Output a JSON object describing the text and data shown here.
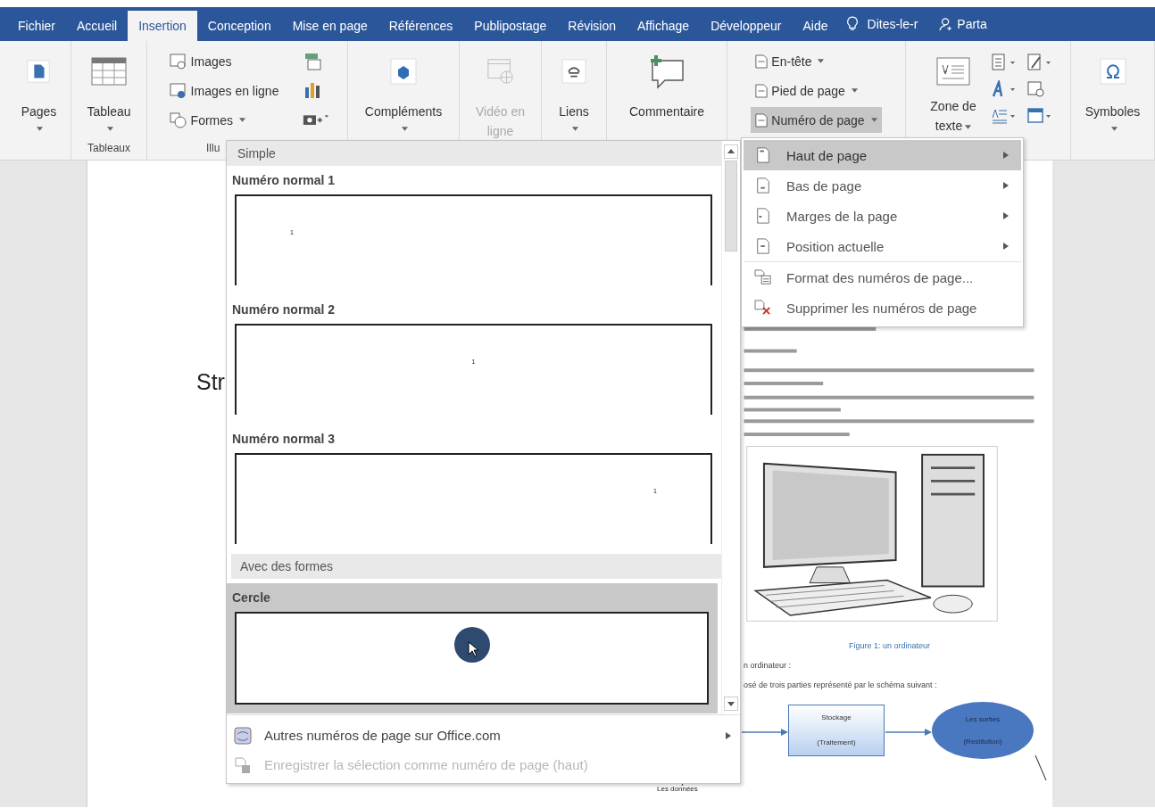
{
  "tabs": [
    {
      "label": "Fichier",
      "selected": false
    },
    {
      "label": "Accueil",
      "selected": false
    },
    {
      "label": "Insertion",
      "selected": true
    },
    {
      "label": "Conception",
      "selected": false
    },
    {
      "label": "Mise en page",
      "selected": false
    },
    {
      "label": "Références",
      "selected": false
    },
    {
      "label": "Publipostage",
      "selected": false
    },
    {
      "label": "Révision",
      "selected": false
    },
    {
      "label": "Affichage",
      "selected": false
    },
    {
      "label": "Développeur",
      "selected": false
    },
    {
      "label": "Aide",
      "selected": false
    }
  ],
  "tell_me": "Dites-le-r",
  "share": "Parta",
  "ribbon": {
    "groups": [
      {
        "kind": "large",
        "buttons": [
          {
            "label": "Pages",
            "dropdown": true,
            "disabled": false
          }
        ]
      },
      {
        "kind": "large",
        "label": "Tableaux",
        "buttons": [
          {
            "label": "Tableau",
            "dropdown": true,
            "disabled": false
          }
        ]
      },
      {
        "kind": "stack",
        "label": "Illu",
        "items": [
          {
            "label": "Images",
            "dropdown": false,
            "selected": false
          },
          {
            "label": "Images en ligne",
            "dropdown": false,
            "selected": false
          },
          {
            "label": "Formes",
            "dropdown": true,
            "selected": false
          }
        ]
      },
      {
        "kind": "large",
        "buttons": [
          {
            "label": "Compléments",
            "dropdown": true,
            "disabled": false
          }
        ]
      },
      {
        "kind": "large",
        "buttons": [
          {
            "label": "Vidéo en ligne",
            "dropdown": false,
            "disabled": true
          }
        ]
      },
      {
        "kind": "large",
        "buttons": [
          {
            "label": "Liens",
            "dropdown": true,
            "disabled": false
          }
        ]
      },
      {
        "kind": "large",
        "buttons": [
          {
            "label": "Commentaire",
            "dropdown": false,
            "disabled": false
          }
        ]
      },
      {
        "kind": "stack",
        "items": [
          {
            "label": "En-tête",
            "dropdown": true,
            "selected": false
          },
          {
            "label": "Pied de page",
            "dropdown": true,
            "selected": false
          },
          {
            "label": "Numéro de page",
            "dropdown": true,
            "selected": true
          }
        ]
      },
      {
        "kind": "large",
        "buttons": [
          {
            "label": "Zone de texte",
            "dropdown": true,
            "disabled": false
          }
        ]
      },
      {
        "kind": "large",
        "buttons": [
          {
            "label": "Symboles",
            "dropdown": true,
            "disabled": false
          }
        ]
      }
    ]
  },
  "gallery": {
    "sections": [
      {
        "heading": "Simple",
        "items": [
          {
            "kind": "left",
            "label": "Numéro normal 1",
            "number": "1",
            "selected": false
          },
          {
            "kind": "center",
            "label": "Numéro normal 2",
            "number": "1",
            "selected": false
          },
          {
            "kind": "right",
            "label": "Numéro normal 3",
            "number": "1",
            "selected": false
          }
        ]
      },
      {
        "heading": "Avec des formes",
        "items": [
          {
            "kind": "circle",
            "label": "Cercle",
            "selected": true
          }
        ]
      }
    ],
    "footer": [
      {
        "label": "Autres numéros de page sur Office.com",
        "submenu": true,
        "disabled": false
      },
      {
        "label": "Enregistrer la sélection comme numéro de page (haut)",
        "submenu": false,
        "disabled": true
      }
    ]
  },
  "submenu": [
    {
      "label": "Haut de page",
      "selected": true,
      "submenu": true,
      "separator_before": false
    },
    {
      "label": "Bas de page",
      "selected": false,
      "submenu": true,
      "separator_before": false
    },
    {
      "label": "Marges de la page",
      "selected": false,
      "submenu": true,
      "separator_before": false
    },
    {
      "label": "Position actuelle",
      "selected": false,
      "submenu": true,
      "separator_before": false
    },
    {
      "label": "Format des numéros de page...",
      "selected": false,
      "submenu": false,
      "separator_before": true
    },
    {
      "label": "Supprimer les numéros de page",
      "selected": false,
      "submenu": false,
      "separator_before": false
    }
  ],
  "document": {
    "heading_fragment": "Str",
    "caption": "Figure 1: un ordinateur",
    "lines": [
      "n ordinateur :",
      "osé de trois parties représenté par le schéma suivant :"
    ],
    "diagram": {
      "box": [
        "Stockage",
        "(Traitement)"
      ],
      "ellipse": [
        "Les sorties",
        "(Restitution)"
      ],
      "input_label": "Les données"
    }
  }
}
